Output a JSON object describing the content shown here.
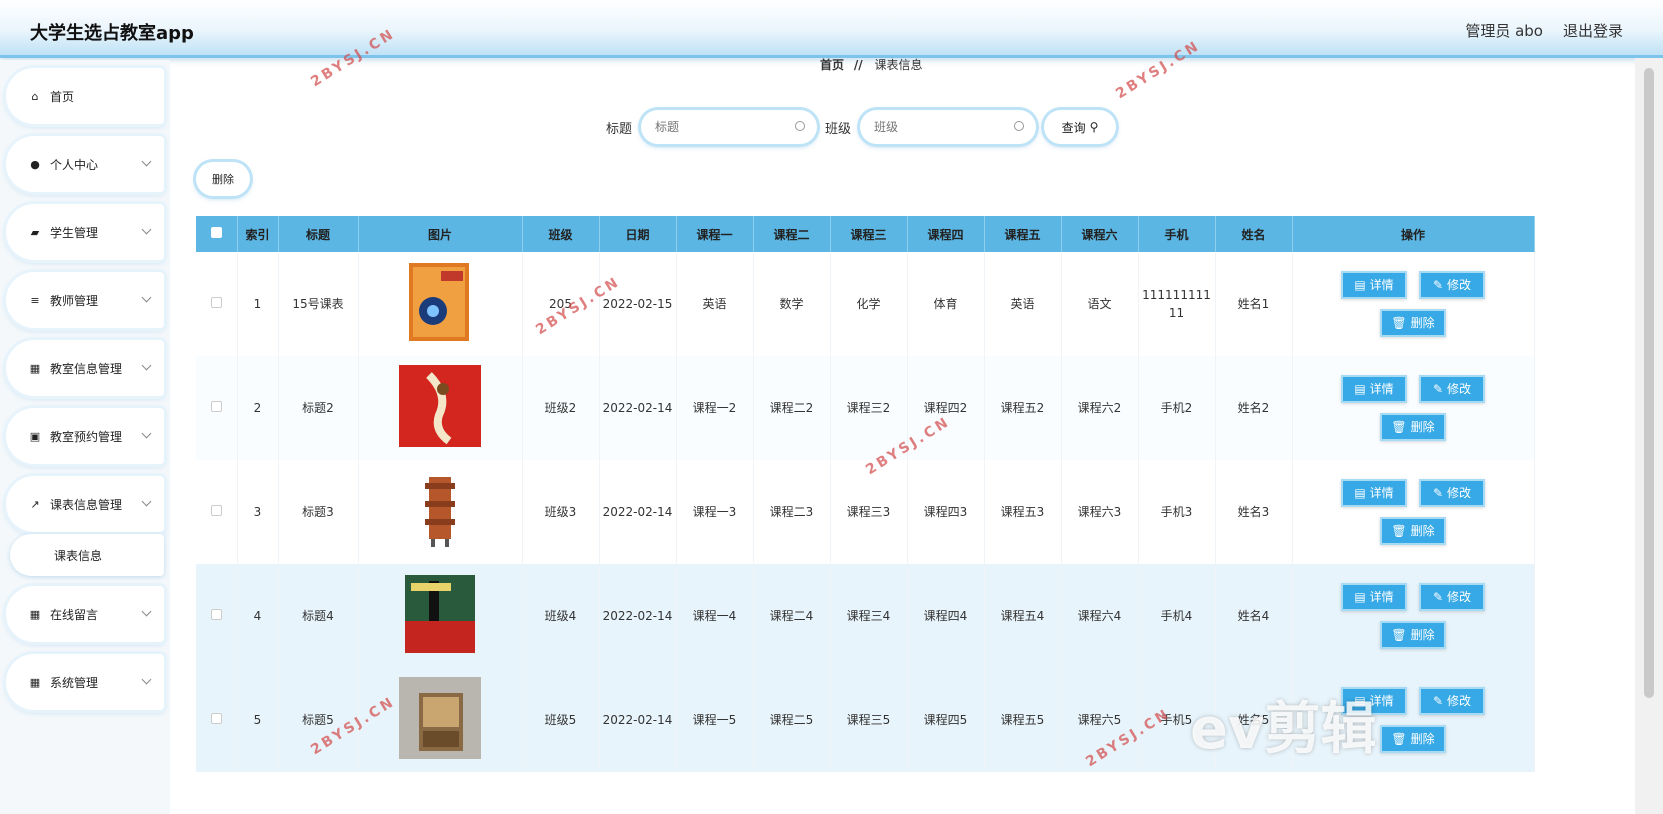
{
  "header": {
    "title": "大学生选占教室app",
    "admin": "管理员 abo",
    "logout": "退出登录"
  },
  "sidebar": {
    "items": [
      {
        "label": "首页",
        "icon": "home-icon"
      },
      {
        "label": "个人中心",
        "icon": "user-icon"
      },
      {
        "label": "学生管理",
        "icon": "briefcase-icon"
      },
      {
        "label": "教师管理",
        "icon": "list-icon"
      },
      {
        "label": "教室信息管理",
        "icon": "grid-icon"
      },
      {
        "label": "教室预约管理",
        "icon": "clipboard-icon"
      },
      {
        "label": "课表信息管理",
        "icon": "chart-icon"
      },
      {
        "label": "在线留言",
        "icon": "grid-icon"
      },
      {
        "label": "系统管理",
        "icon": "grid-icon"
      }
    ],
    "sub_item": "课表信息"
  },
  "breadcrumb": {
    "home": "首页",
    "sep": "//",
    "current": "课表信息"
  },
  "search": {
    "title_label": "标题",
    "title_placeholder": "标题",
    "class_label": "班级",
    "class_placeholder": "班级",
    "query_label": "查询"
  },
  "toolbar": {
    "delete_label": "删除"
  },
  "table": {
    "headers": [
      "索引",
      "标题",
      "图片",
      "班级",
      "日期",
      "课程一",
      "课程二",
      "课程三",
      "课程四",
      "课程五",
      "课程六",
      "手机",
      "姓名",
      "操作"
    ],
    "rows": [
      {
        "idx": "1",
        "title": "15号课表",
        "cls": "205",
        "date": "2022-02-15",
        "c1": "英语",
        "c2": "数学",
        "c3": "化学",
        "c4": "体育",
        "c5": "英语",
        "c6": "语文",
        "phone": "11111111111",
        "name": "姓名1"
      },
      {
        "idx": "2",
        "title": "标题2",
        "cls": "班级2",
        "date": "2022-02-14",
        "c1": "课程一2",
        "c2": "课程二2",
        "c3": "课程三2",
        "c4": "课程四2",
        "c5": "课程五2",
        "c6": "课程六2",
        "phone": "手机2",
        "name": "姓名2"
      },
      {
        "idx": "3",
        "title": "标题3",
        "cls": "班级3",
        "date": "2022-02-14",
        "c1": "课程一3",
        "c2": "课程二3",
        "c3": "课程三3",
        "c4": "课程四3",
        "c5": "课程五3",
        "c6": "课程六3",
        "phone": "手机3",
        "name": "姓名3"
      },
      {
        "idx": "4",
        "title": "标题4",
        "cls": "班级4",
        "date": "2022-02-14",
        "c1": "课程一4",
        "c2": "课程二4",
        "c3": "课程三4",
        "c4": "课程四4",
        "c5": "课程五4",
        "c6": "课程六4",
        "phone": "手机4",
        "name": "姓名4"
      },
      {
        "idx": "5",
        "title": "标题5",
        "cls": "班级5",
        "date": "2022-02-14",
        "c1": "课程一5",
        "c2": "课程二5",
        "c3": "课程三5",
        "c4": "课程四5",
        "c5": "课程五5",
        "c6": "课程六5",
        "phone": "手机5",
        "name": "姓名5"
      }
    ],
    "ops": {
      "detail": "详情",
      "edit": "修改",
      "delete": "删除"
    }
  },
  "watermark": {
    "text": "2BYSJ.CN",
    "logo": "ev剪辑"
  },
  "colors": {
    "accent": "#37a9e6",
    "header_row": "#5bb6e3"
  }
}
